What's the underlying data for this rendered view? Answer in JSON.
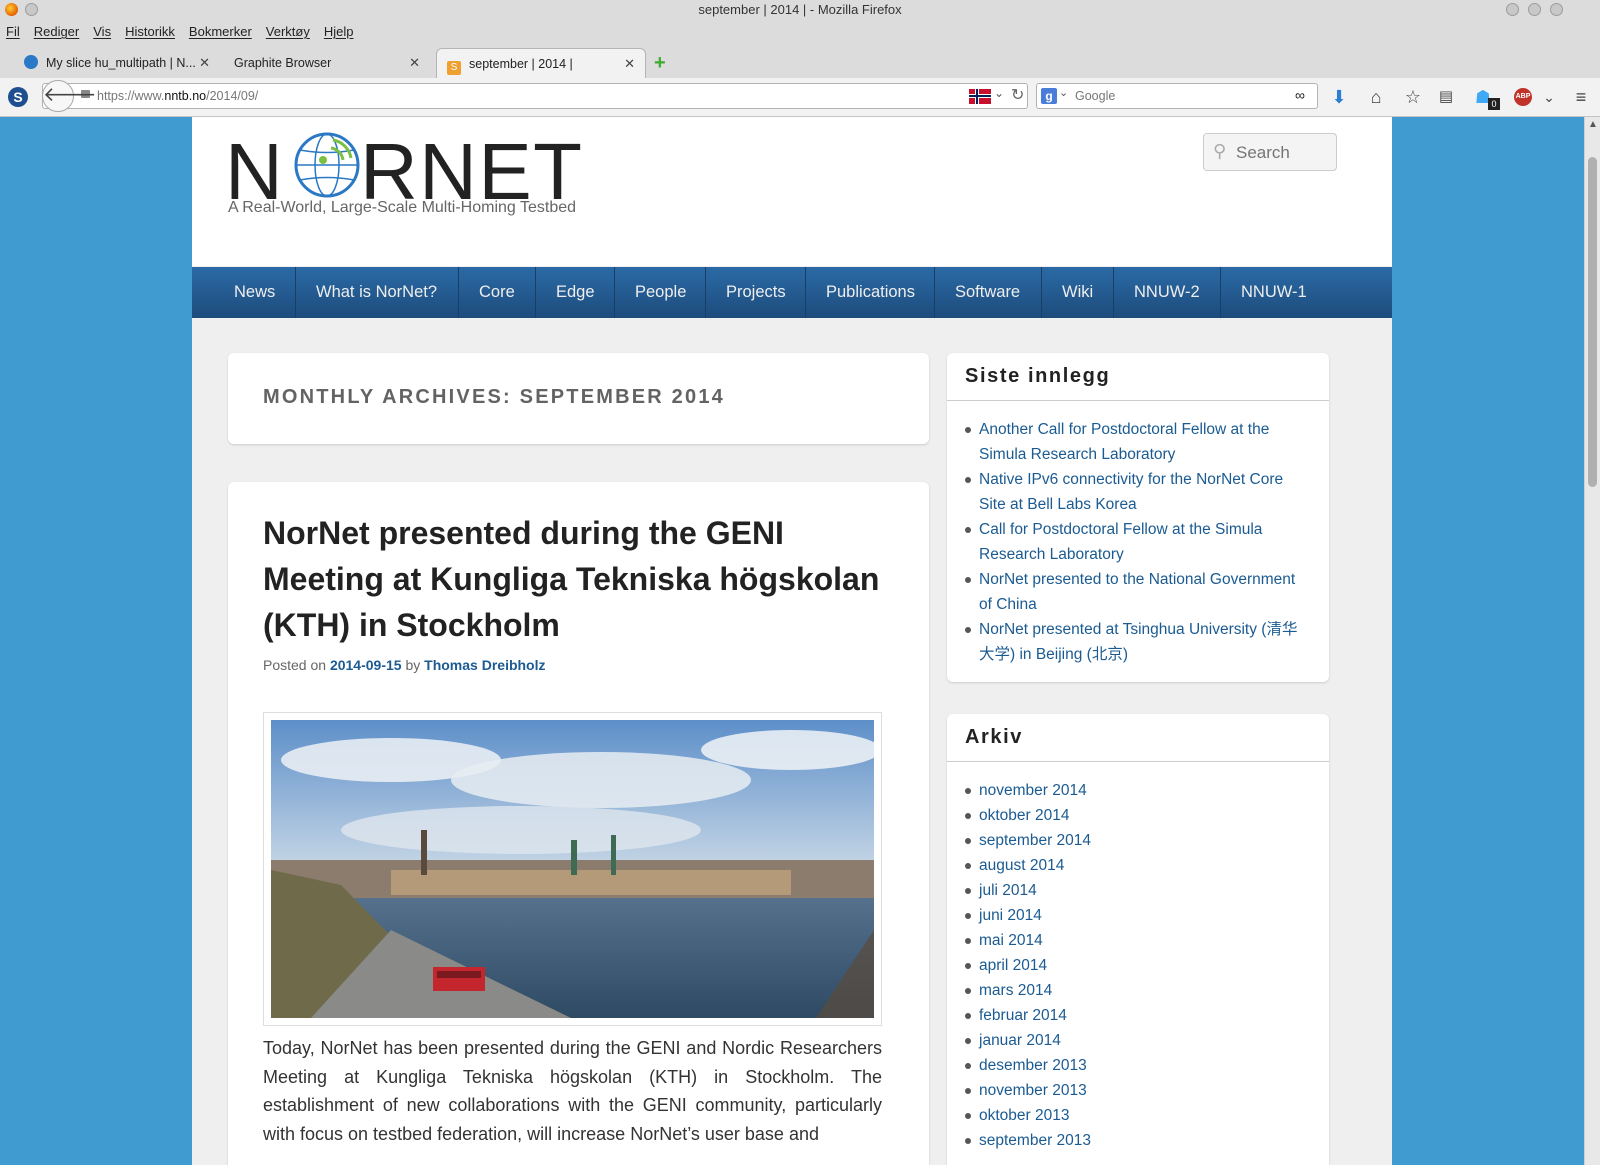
{
  "window": {
    "title": "september | 2014 | - Mozilla Firefox"
  },
  "menubar": [
    "Fil",
    "Rediger",
    "Vis",
    "Historikk",
    "Bokmerker",
    "Verktøy",
    "Hjelp"
  ],
  "tabs": [
    {
      "label": "My slice hu_multipath | N..."
    },
    {
      "label": "Graphite Browser"
    },
    {
      "label": "september | 2014 |"
    }
  ],
  "navbar": {
    "url_prefix": "https://www.",
    "url_host": "nntb.no",
    "url_path": "/2014/09/",
    "search_placeholder": "Google",
    "badge_count": "0"
  },
  "site": {
    "logo_text": "NORNET",
    "tagline": "A Real-World, Large-Scale Multi-Homing Testbed",
    "search_placeholder": "Search",
    "menu": [
      "News",
      "What is NorNet?",
      "Core",
      "Edge",
      "People",
      "Projects",
      "Publications",
      "Software",
      "Wiki",
      "NNUW-2",
      "NNUW-1"
    ]
  },
  "archive": {
    "heading": "MONTHLY ARCHIVES: SEPTEMBER 2014"
  },
  "post": {
    "title": "NorNet presented during the GENI Meeting at Kungliga Tekniska högskolan (KTH) in Stockholm",
    "posted_on": "Posted on",
    "date": "2014-09-15",
    "by": "by",
    "author": "Thomas Dreibholz",
    "body": "Today, NorNet has been presented during the GENI and Nordic Researchers Meeting at Kungliga Tekniska högskolan (KTH) in Stockholm. The establishment of new collaborations with the GENI community, particularly with focus on testbed federation, will increase NorNet’s user base and"
  },
  "sidebar": {
    "recent": {
      "title": "Siste innlegg",
      "items": [
        "Another Call for Postdoctoral Fellow at the Simula Research Laboratory",
        "Native IPv6 connectivity for the NorNet Core Site at Bell Labs Korea",
        "Call for Postdoctoral Fellow at the Simula Research Laboratory",
        "NorNet presented to the National Government of China",
        "NorNet presented at Tsinghua University (清华大学) in Beijing (北京)"
      ]
    },
    "archive": {
      "title": "Arkiv",
      "items": [
        "november 2014",
        "oktober 2014",
        "september 2014",
        "august 2014",
        "juli 2014",
        "juni 2014",
        "mai 2014",
        "april 2014",
        "mars 2014",
        "februar 2014",
        "januar 2014",
        "desember 2013",
        "november 2013",
        "oktober 2013",
        "september 2013"
      ]
    }
  }
}
